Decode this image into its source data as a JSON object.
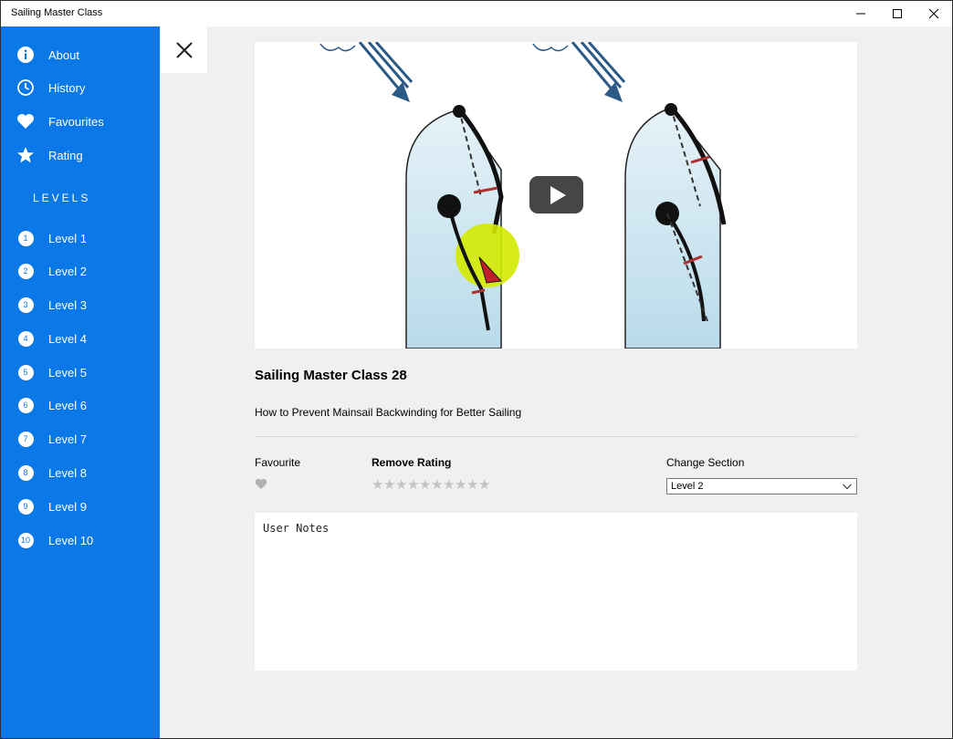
{
  "window": {
    "title": "Sailing Master Class"
  },
  "sidebar": {
    "items": [
      {
        "label": "About",
        "icon": "info-icon"
      },
      {
        "label": "History",
        "icon": "clock-icon"
      },
      {
        "label": "Favourites",
        "icon": "heart-icon"
      },
      {
        "label": "Rating",
        "icon": "star-icon"
      }
    ],
    "levels_header": "LEVELS",
    "levels": [
      {
        "num": "1",
        "label": "Level 1"
      },
      {
        "num": "2",
        "label": "Level 2"
      },
      {
        "num": "3",
        "label": "Level 3"
      },
      {
        "num": "4",
        "label": "Level 4"
      },
      {
        "num": "5",
        "label": "Level 5"
      },
      {
        "num": "6",
        "label": "Level 6"
      },
      {
        "num": "7",
        "label": "Level 7"
      },
      {
        "num": "8",
        "label": "Level 8"
      },
      {
        "num": "9",
        "label": "Level 9"
      },
      {
        "num": "10",
        "label": "Level 10"
      }
    ]
  },
  "main": {
    "title": "Sailing Master Class 28",
    "description": "How to Prevent Mainsail Backwinding for Better Sailing",
    "favourite_label": "Favourite",
    "rating_label": "Remove Rating",
    "star_count": 10,
    "section_label": "Change Section",
    "section_value": "Level 2",
    "notes_text": "User Notes"
  },
  "colors": {
    "sidebar": "#0b78e8",
    "content_bg": "#f0f0f0",
    "star_empty": "#c4c4c4",
    "heart_empty": "#b0b0b0"
  }
}
